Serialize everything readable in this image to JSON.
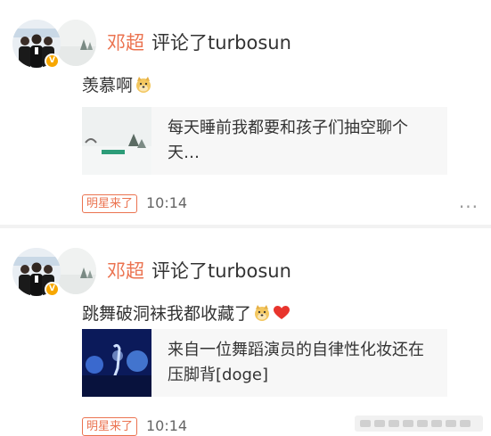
{
  "feed": {
    "items": [
      {
        "username": "邓超",
        "action": "评论了",
        "target_user": "turbosun",
        "comment_text": "羡慕啊",
        "comment_suffix": "",
        "emojis": [
          "doge-emoji"
        ],
        "quote_text": "每天睡前我都要和孩子们抽空聊个天…",
        "badge": "明星来了",
        "time": "10:14",
        "more": "···"
      },
      {
        "username": "邓超",
        "action": "评论了",
        "target_user": "turbosun",
        "comment_text": "跳舞破洞袜我都收藏了",
        "emojis": [
          "doge-emoji",
          "heart-emoji"
        ],
        "quote_text": "来自一位舞蹈演员的自律性化妆还在压脚背[doge]",
        "badge": "明星来了",
        "time": "10:14"
      }
    ]
  },
  "colors": {
    "username": "#eb7350",
    "badge_border": "#eb7350",
    "divider": "#f2f2f2",
    "quote_bg": "#f7f7f7"
  }
}
